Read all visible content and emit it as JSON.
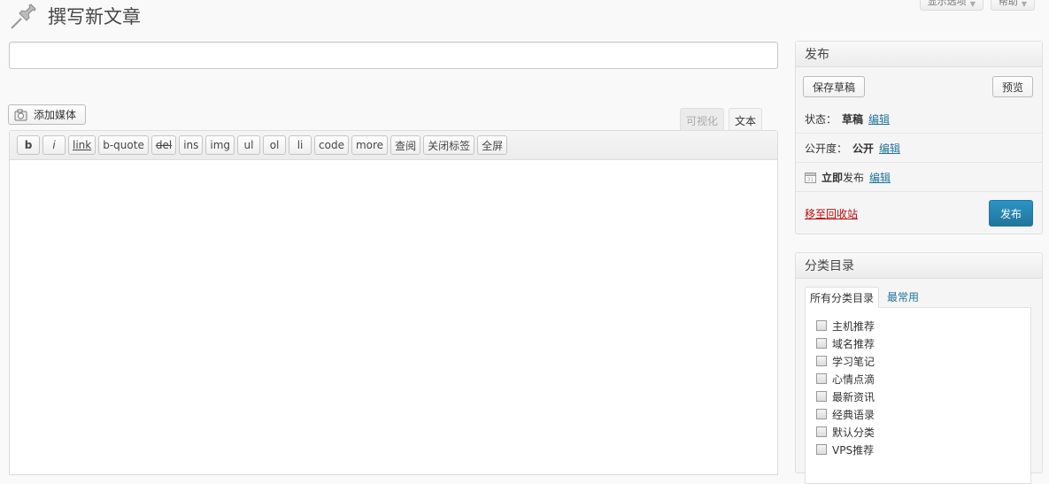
{
  "screen_meta": {
    "options_label": "显示选项",
    "help_label": "帮助"
  },
  "header": {
    "title": "撰写新文章"
  },
  "title_input": {
    "value": ""
  },
  "media": {
    "add_label": "添加媒体"
  },
  "editor": {
    "tabs": [
      {
        "label": "可视化",
        "active": false
      },
      {
        "label": "文本",
        "active": true
      }
    ],
    "quicktags": [
      "b",
      "i",
      "link",
      "b-quote",
      "del",
      "ins",
      "img",
      "ul",
      "ol",
      "li",
      "code",
      "more",
      "查阅",
      "关闭标签",
      "全屏"
    ],
    "content": ""
  },
  "publish": {
    "title": "发布",
    "save_draft": "保存草稿",
    "preview": "预览",
    "status_label": "状态：",
    "status_value": "草稿",
    "visibility_label": "公开度：",
    "visibility_value": "公开",
    "schedule_strong": "立即",
    "schedule_rest": "发布",
    "edit_label": "编辑",
    "trash_label": "移至回收站",
    "publish_label": "发布",
    "accent_color": "#21759b",
    "trash_color": "#bc0b0b"
  },
  "categories": {
    "title": "分类目录",
    "tab_all": "所有分类目录",
    "tab_common": "最常用",
    "items": [
      "主机推荐",
      "域名推荐",
      "学习笔记",
      "心情点滴",
      "最新资讯",
      "经典语录",
      "默认分类",
      "VPS推荐"
    ]
  }
}
